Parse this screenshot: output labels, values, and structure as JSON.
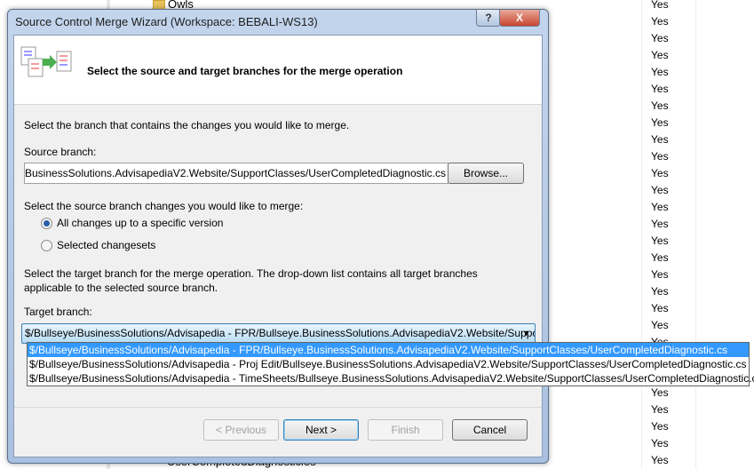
{
  "background": {
    "tree_item_top": "Owls",
    "tree_item_bottom": "UserCompletedDiagnosticles",
    "yes_values": [
      "Yes",
      "Yes",
      "Yes",
      "Yes",
      "Yes",
      "Yes",
      "Yes",
      "Yes",
      "Yes",
      "Yes",
      "Yes",
      "Yes",
      "Yes",
      "Yes",
      "Yes",
      "Yes",
      "Yes",
      "Yes",
      "Yes",
      "Yes",
      "Yes",
      "Yes",
      "Yes",
      "Yes",
      "Yes",
      "Yes",
      "Yes",
      "Yes"
    ]
  },
  "dialog": {
    "title": "Source Control Merge Wizard (Workspace: BEBALI-WS13)",
    "help_label": "?",
    "close_label": "X",
    "header_text": "Select the source and target branches for the merge operation",
    "intro": "Select the branch that contains the changes you would like to merge.",
    "source_label": "Source branch:",
    "source_value": "$/Bullseye/BusinessSolutions/Advisapedia - FPR/Bullseye.BusinessSolutions.AdvisapediaV2.Website/SupportClasses/UserCompletedDiagnostic.cs",
    "browse_label": "Browse...",
    "changes_label": "Select the source branch changes you would like to merge:",
    "radio_all": "All changes up to a specific version",
    "radio_selected": "Selected changesets",
    "radio_checked": "all",
    "target_desc": "Select the target branch for the merge operation.  The drop-down list contains all target branches applicable to the selected source branch.",
    "target_label": "Target branch:",
    "target_value": "$/Bullseye/BusinessSolutions/Advisapedia - FPR/Bullseye.BusinessSolutions.AdvisapediaV2.Website/SupportClasses/UserCompletedDiagnostic.cs",
    "target_options": [
      "$/Bullseye/BusinessSolutions/Advisapedia - FPR/Bullseye.BusinessSolutions.AdvisapediaV2.Website/SupportClasses/UserCompletedDiagnostic.cs",
      "$/Bullseye/BusinessSolutions/Advisapedia - Proj Edit/Bullseye.BusinessSolutions.AdvisapediaV2.Website/SupportClasses/UserCompletedDiagnostic.cs",
      "$/Bullseye/BusinessSolutions/Advisapedia - TimeSheets/Bullseye.BusinessSolutions.AdvisapediaV2.Website/SupportClasses/UserCompletedDiagnostic.cs"
    ],
    "buttons": {
      "previous": "< Previous",
      "next": "Next >",
      "finish": "Finish",
      "cancel": "Cancel"
    },
    "colors": {
      "selection": "#3399ff",
      "title_bar": "#c3d5ec"
    }
  }
}
